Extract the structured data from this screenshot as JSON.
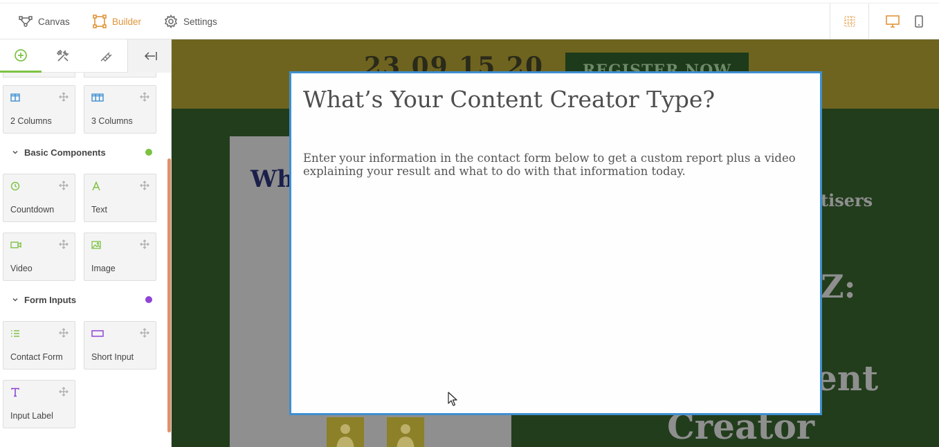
{
  "topbar": {
    "canvas_label": "Canvas",
    "builder_label": "Builder",
    "settings_label": "Settings",
    "accent": "#e0943a"
  },
  "sidebar": {
    "tiles_layout": [
      {
        "label": "2 Columns",
        "icon": "two-columns-icon"
      },
      {
        "label": "3 Columns",
        "icon": "three-columns-icon"
      }
    ],
    "section_basic": {
      "label": "Basic Components",
      "dot_color": "#7cc242"
    },
    "tiles_basic": [
      {
        "label": "Countdown",
        "icon": "clock-icon"
      },
      {
        "label": "Text",
        "icon": "text-a-icon"
      },
      {
        "label": "Video",
        "icon": "video-icon"
      },
      {
        "label": "Image",
        "icon": "image-icon"
      }
    ],
    "section_form": {
      "label": "Form Inputs",
      "dot_color": "#8e44d6"
    },
    "tiles_form": [
      {
        "label": "Contact Form",
        "icon": "list-icon"
      },
      {
        "label": "Short Input",
        "icon": "input-box-icon"
      },
      {
        "label": "Input Label",
        "icon": "text-t-icon"
      }
    ]
  },
  "canvas": {
    "countdown": "23  09  15  20",
    "register_label": "REGISTER NOW",
    "left_heading": "Wh",
    "right_text_1": "tisers",
    "right_text_2": "Z:",
    "right_text_3": "ent",
    "right_text_4": "Creator"
  },
  "modal": {
    "title": "What’s Your Content Creator Type?",
    "body": "Enter your  information in the contact form below to get a custom report plus a video explaining your result and what to do with that information today."
  }
}
